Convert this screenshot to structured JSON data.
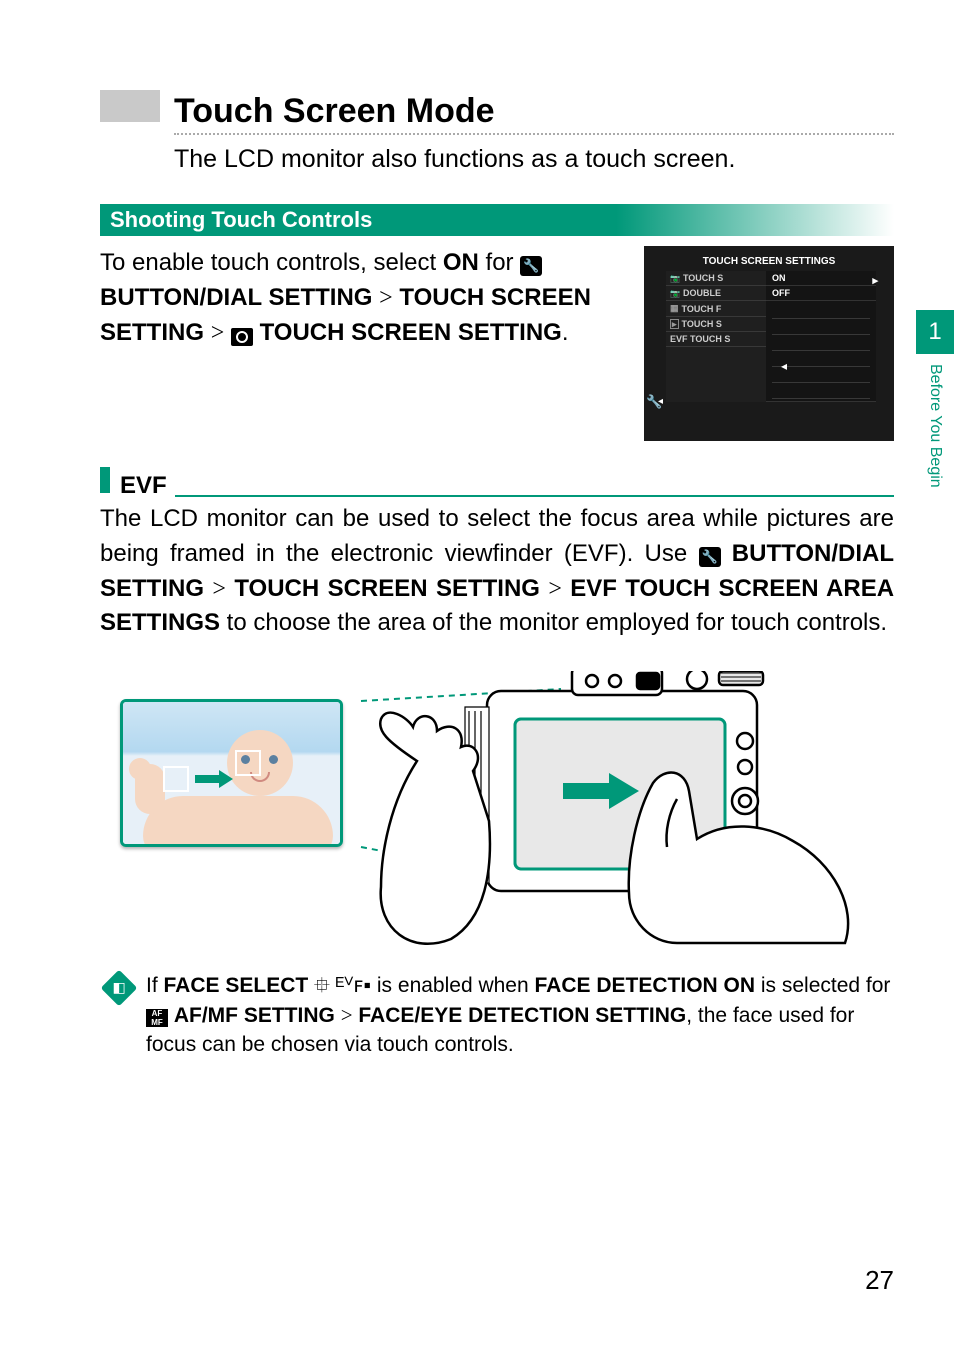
{
  "side": {
    "chapter": "1",
    "section": "Before You Begin"
  },
  "title": "Touch Screen Mode",
  "intro": "The LCD monitor also functions as a touch screen.",
  "shooting": {
    "header": "Shooting Touch Controls",
    "p1a": "To enable touch controls, select ",
    "p1_on": "ON",
    "p1b": " for ",
    "p1_btn": "BUTTON/DIAL SETTING",
    "gt": ">",
    "p1_tss": "TOUCH SCREEN SETTING",
    "p1_ts": "TOUCH SCREEN SETTING",
    "p1end": "."
  },
  "menu": {
    "title": "TOUCH SCREEN SETTINGS",
    "left": [
      "TOUCH S",
      "DOUBLE",
      "TOUCH F",
      "TOUCH S",
      "EVF TOUCH S"
    ],
    "right": [
      "ON",
      "OFF"
    ]
  },
  "evf": {
    "header": "EVF",
    "p1": "The LCD monitor can be used to select the focus area while pictures are being framed in the electronic viewfinder (EVF). Use ",
    "b1": "BUTTON/DIAL SETTING",
    "gt": ">",
    "b2": "TOUCH SCREEN SETTING",
    "b3": "EVF TOUCH SCREEN AREA SETTINGS",
    "p2": " to choose the area of the monitor employed for touch controls."
  },
  "note": {
    "t1": "If ",
    "b1": "FACE SELECT",
    "icons": "⯐ ᴱⱽꜰ▪",
    "t2": " is enabled when ",
    "b2": "FACE DETECTION ON",
    "t3": " is selected for ",
    "b3": "AF/MF SETTING",
    "gt": ">",
    "b4": "FACE/EYE DETECTION SETTING",
    "t4": ", the face used for focus can be chosen via touch controls."
  },
  "page_number": "27"
}
